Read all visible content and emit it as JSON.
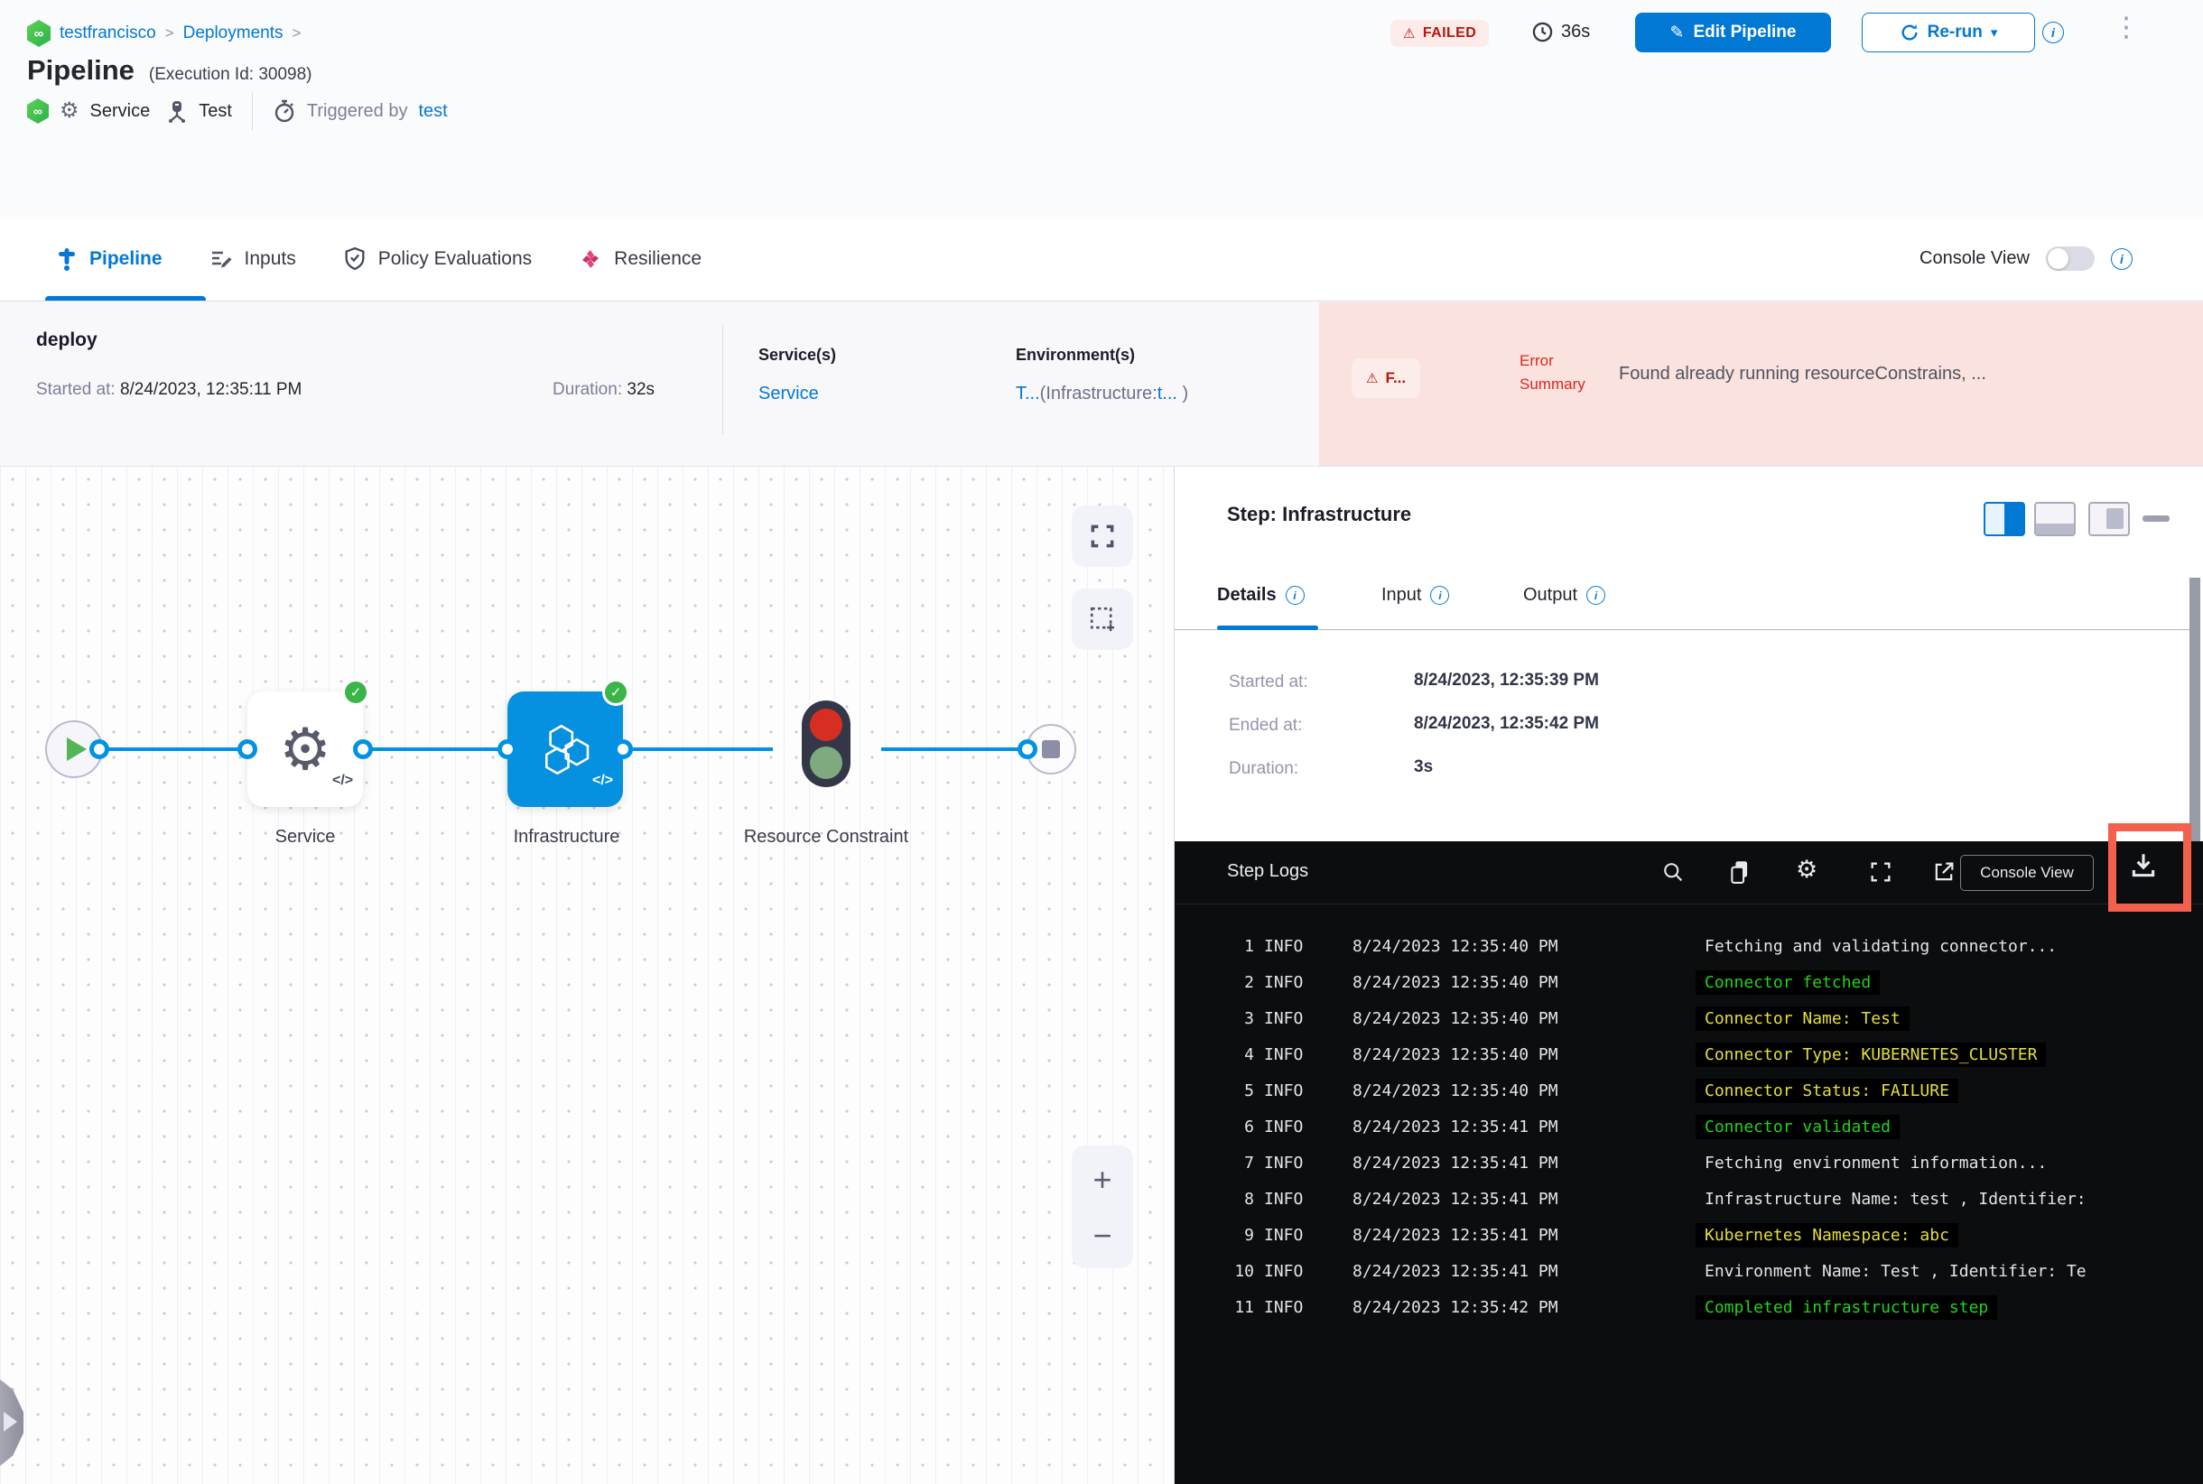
{
  "icons": {
    "infinity": "∞",
    "gear": "⚙",
    "pencil": "✎",
    "caret": "▾",
    "dots": "⋮",
    "warning": "⚠",
    "check": "✓",
    "info": "i",
    "code": "</>",
    "chevron": ">",
    "plus": "+",
    "minus": "−"
  },
  "breadcrumb": {
    "project": "testfrancisco",
    "section": "Deployments"
  },
  "header": {
    "title": "Pipeline",
    "execution_id": "(Execution Id: 30098)",
    "status": "FAILED",
    "elapsed": "36s",
    "edit_button": "Edit Pipeline",
    "rerun_button": "Re-run",
    "service_label": "Service",
    "test_label": "Test",
    "triggered_by_label": "Triggered by",
    "triggered_by_user": "test"
  },
  "tabs": {
    "items": [
      {
        "label": "Pipeline"
      },
      {
        "label": "Inputs"
      },
      {
        "label": "Policy Evaluations"
      },
      {
        "label": "Resilience"
      }
    ],
    "console_view_label": "Console View"
  },
  "stage": {
    "name": "deploy",
    "started_label": "Started at:",
    "started_value": "8/24/2023, 12:35:11 PM",
    "duration_label": "Duration:",
    "duration_value": "32s",
    "services_label": "Service(s)",
    "services_value": "Service",
    "environments_label": "Environment(s)",
    "env_link1": "T...",
    "env_text1": "(Infrastructure:",
    "env_link2": "t...",
    "env_text2": " )",
    "error_badge": "F...",
    "error_summary_label": "Error Summary",
    "error_message": "Found already running resourceConstrains, ..."
  },
  "graph": {
    "nodes": [
      {
        "label": "Service"
      },
      {
        "label": "Infrastructure"
      },
      {
        "label": "Resource Constraint"
      }
    ]
  },
  "step_panel": {
    "title": "Step: Infrastructure",
    "tabs": [
      {
        "label": "Details"
      },
      {
        "label": "Input"
      },
      {
        "label": "Output"
      }
    ],
    "fields": [
      {
        "label": "Started at:",
        "value": "8/24/2023, 12:35:39 PM"
      },
      {
        "label": "Ended at:",
        "value": "8/24/2023, 12:35:42 PM"
      },
      {
        "label": "Duration:",
        "value": "3s"
      }
    ]
  },
  "logs": {
    "title": "Step Logs",
    "console_view_button": "Console View",
    "entries": [
      {
        "n": "1",
        "level": "INFO",
        "time": "8/24/2023 12:35:40 PM",
        "message": "Fetching and validating connector...",
        "color": "white"
      },
      {
        "n": "2",
        "level": "INFO",
        "time": "8/24/2023 12:35:40 PM",
        "message": "Connector fetched",
        "color": "green"
      },
      {
        "n": "3",
        "level": "INFO",
        "time": "8/24/2023 12:35:40 PM",
        "message": "Connector Name: Test",
        "color": "yellow"
      },
      {
        "n": "4",
        "level": "INFO",
        "time": "8/24/2023 12:35:40 PM",
        "message": "Connector Type: KUBERNETES_CLUSTER",
        "color": "yellow"
      },
      {
        "n": "5",
        "level": "INFO",
        "time": "8/24/2023 12:35:40 PM",
        "message": "Connector Status: FAILURE",
        "color": "yellow"
      },
      {
        "n": "6",
        "level": "INFO",
        "time": "8/24/2023 12:35:41 PM",
        "message": "Connector validated",
        "color": "green"
      },
      {
        "n": "7",
        "level": "INFO",
        "time": "8/24/2023 12:35:41 PM",
        "message": "Fetching environment information...",
        "color": "white"
      },
      {
        "n": "8",
        "level": "INFO",
        "time": "8/24/2023 12:35:41 PM",
        "message": "Infrastructure Name: test , Identifier:",
        "color": "white"
      },
      {
        "n": "9",
        "level": "INFO",
        "time": "8/24/2023 12:35:41 PM",
        "message": "Kubernetes Namespace: abc",
        "color": "yellow"
      },
      {
        "n": "10",
        "level": "INFO",
        "time": "8/24/2023 12:35:41 PM",
        "message": "Environment Name: Test , Identifier: Te",
        "color": "white"
      },
      {
        "n": "11",
        "level": "INFO",
        "time": "8/24/2023 12:35:42 PM",
        "message": "Completed infrastructure step",
        "color": "green"
      }
    ]
  },
  "colors": {
    "accent": "#0278d5",
    "failed_red": "#b41710",
    "success_green": "#3bb54a",
    "edge_blue": "#0092e4",
    "highlight_red": "#f4604c",
    "log_green": "#21d41c",
    "log_yellow": "#e6df37"
  }
}
